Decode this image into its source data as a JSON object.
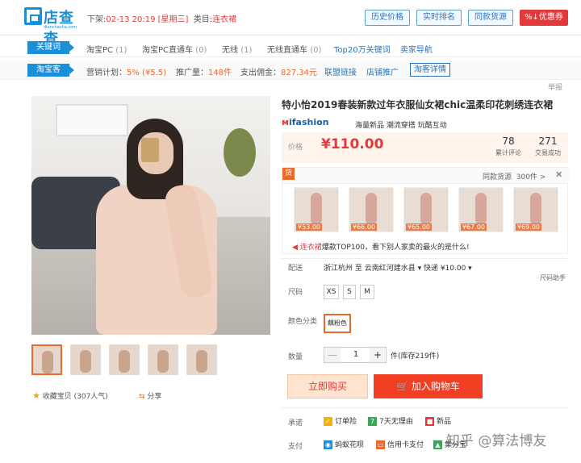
{
  "header": {
    "logo_text": "店查查",
    "logo_sub": "dianchacha.com",
    "delist_label": "下架:",
    "delist_time": "02-13 20:19 [星期三]",
    "category_label": "类目:",
    "category": "连衣裙",
    "buttons": [
      "历史价格",
      "实时排名",
      "同款货源",
      "%↓优惠券"
    ]
  },
  "keywords_row": {
    "tag": "关键词",
    "items": [
      {
        "label": "淘宝PC",
        "count": "(1)"
      },
      {
        "label": "淘宝PC直通车",
        "count": "(0)"
      },
      {
        "label": "无线",
        "count": "(1)"
      },
      {
        "label": "无线直通车",
        "count": "(0)"
      }
    ],
    "links": [
      "Top20万关键词",
      "卖家导航"
    ]
  },
  "taoke_row": {
    "tag": "淘宝客",
    "plan_label": "营销计划：",
    "plan_value": "5% (¥5.5)",
    "promo_label": "推广量：",
    "promo_value": "148件",
    "spend_label": "支出佣金：",
    "spend_value": "827.34元",
    "links": [
      "联盟链接",
      "店铺推广"
    ],
    "detail_button": "淘客详情"
  },
  "report": "举报",
  "product": {
    "title": "特小怡2019春装新款过年衣服仙女裙chic温柔印花刺绣连衣裙",
    "brand": "ifashion",
    "brand_tags": "海量新品  潮流穿搭  玩酷互动",
    "price_label": "价格",
    "price": "¥110.00",
    "reviews_count": "78",
    "reviews_label": "累计评论",
    "sold_count": "271",
    "sold_label": "交易成功"
  },
  "similar": {
    "badge": "货",
    "source_label": "同款货源",
    "source_count": "300件 >",
    "close": "✕",
    "prices": [
      "¥53.00",
      "¥66.00",
      "¥65.00",
      "¥67.00",
      "¥69.00"
    ],
    "hot_keyword": "连衣裙",
    "hot_text": "爆款TOP100，看下别人家卖的最火的是什么!"
  },
  "options": {
    "ship_label": "配送",
    "ship_value": "浙江杭州 至  云南红河建水县 ▾   快递 ¥10.00 ▾",
    "size_guide": "尺码助手",
    "size_label": "尺码",
    "sizes": [
      "XS",
      "S",
      "M"
    ],
    "color_label": "颜色分类",
    "color": "藕粉色",
    "qty_label": "数量",
    "qty_minus": "—",
    "qty_value": "1",
    "qty_plus": "+",
    "stock": "件(库存219件)"
  },
  "actions": {
    "buy_now": "立即购买",
    "add_cart": "加入购物车",
    "cart_icon": "🛒"
  },
  "promise": {
    "label": "承诺",
    "items": [
      "订单险",
      "7天无理由",
      "新品"
    ]
  },
  "payment": {
    "label": "支付",
    "items": [
      "蚂蚁花呗",
      "信用卡支付",
      "集分宝"
    ]
  },
  "gallery": {
    "favorite": "收藏宝贝 (307人气)",
    "share": "分享",
    "zoom_icon": "search-icon"
  },
  "watermark": "知乎 @算法博友"
}
